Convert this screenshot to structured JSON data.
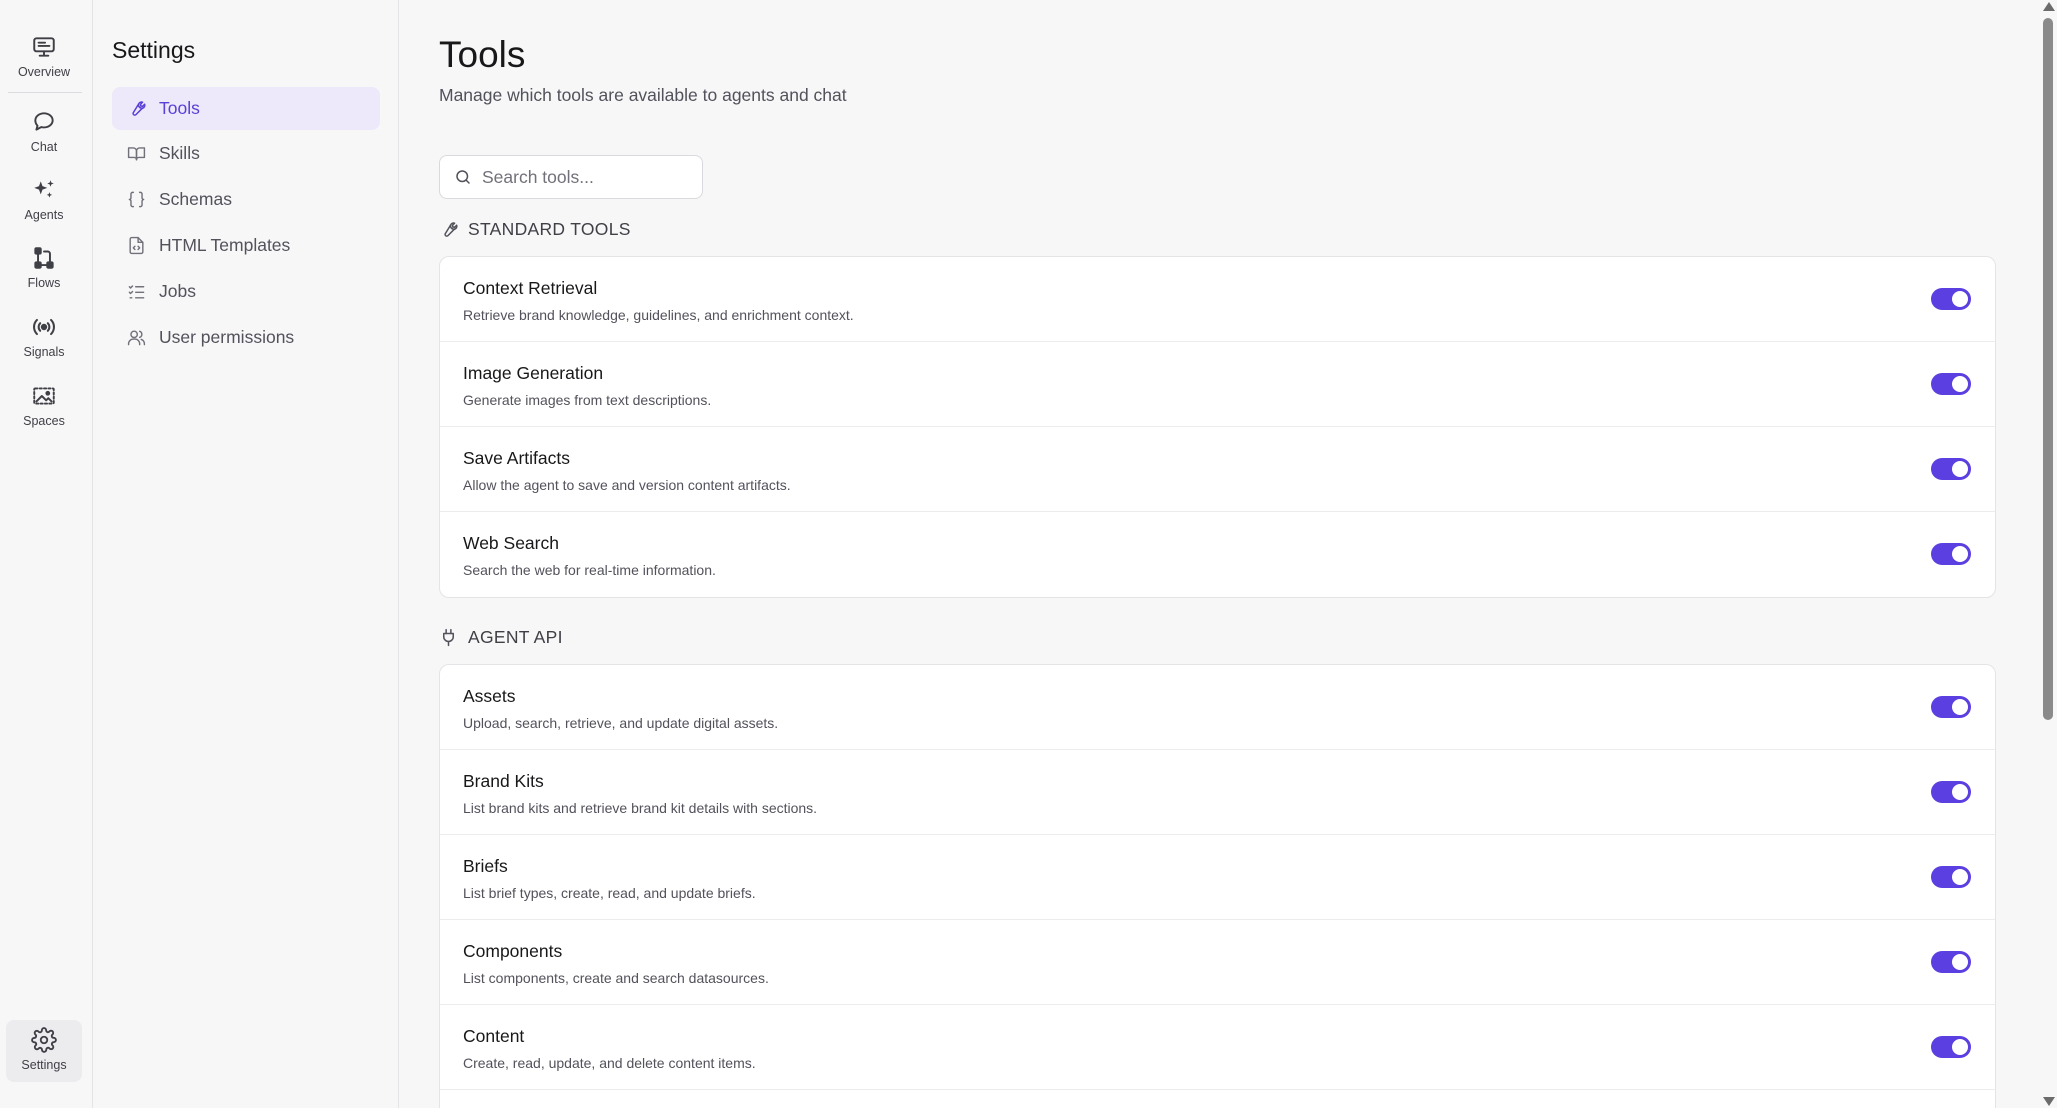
{
  "rail": {
    "items": [
      {
        "label": "Overview",
        "icon": "monitor-icon"
      },
      {
        "label": "Chat",
        "icon": "chat-bubble-icon"
      },
      {
        "label": "Agents",
        "icon": "sparkles-icon"
      },
      {
        "label": "Flows",
        "icon": "flow-icon"
      },
      {
        "label": "Signals",
        "icon": "broadcast-icon"
      },
      {
        "label": "Spaces",
        "icon": "image-frame-icon"
      }
    ],
    "settings_label": "Settings"
  },
  "settings_nav": {
    "title": "Settings",
    "items": [
      {
        "label": "Tools",
        "icon": "wrench-icon",
        "active": true
      },
      {
        "label": "Skills",
        "icon": "book-icon"
      },
      {
        "label": "Schemas",
        "icon": "braces-icon"
      },
      {
        "label": "HTML Templates",
        "icon": "file-code-icon"
      },
      {
        "label": "Jobs",
        "icon": "checklist-icon"
      },
      {
        "label": "User permissions",
        "icon": "users-icon"
      }
    ]
  },
  "main": {
    "title": "Tools",
    "subtitle": "Manage which tools are available to agents and chat",
    "search_placeholder": "Search tools..."
  },
  "sections": [
    {
      "title": "STANDARD TOOLS",
      "icon": "wrench-icon",
      "tools": [
        {
          "name": "Context Retrieval",
          "description": "Retrieve brand knowledge, guidelines, and enrichment context.",
          "enabled": true
        },
        {
          "name": "Image Generation",
          "description": "Generate images from text descriptions.",
          "enabled": true
        },
        {
          "name": "Save Artifacts",
          "description": "Allow the agent to save and version content artifacts.",
          "enabled": true
        },
        {
          "name": "Web Search",
          "description": "Search the web for real-time information.",
          "enabled": true
        }
      ]
    },
    {
      "title": "AGENT API",
      "icon": "plug-icon",
      "tools": [
        {
          "name": "Assets",
          "description": "Upload, search, retrieve, and update digital assets.",
          "enabled": true
        },
        {
          "name": "Brand Kits",
          "description": "List brand kits and retrieve brand kit details with sections.",
          "enabled": true
        },
        {
          "name": "Briefs",
          "description": "List brief types, create, read, and update briefs.",
          "enabled": true
        },
        {
          "name": "Components",
          "description": "List components, create and search datasources.",
          "enabled": true
        },
        {
          "name": "Content",
          "description": "Create, read, update, and delete content items.",
          "enabled": true
        }
      ]
    }
  ],
  "colors": {
    "accent": "#5b3fe0",
    "active_nav_bg": "#ede9fb",
    "active_nav_text": "#5b3fd6"
  }
}
